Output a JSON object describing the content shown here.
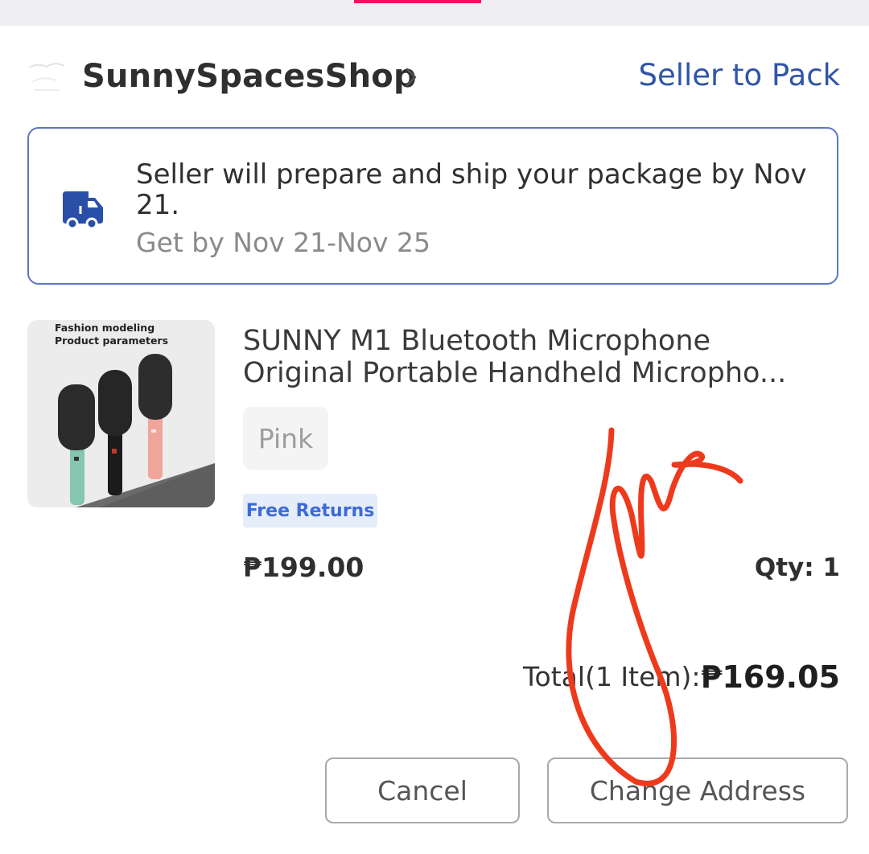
{
  "order": {
    "shop_name": "SunnySpacesShop",
    "status": "Seller to Pack",
    "shipping": {
      "message": "Seller will prepare and ship your package by Nov 21.",
      "estimate": "Get by Nov 21-Nov 25"
    },
    "item": {
      "thumbnail_text": {
        "line1": "Fashion modeling",
        "line2": "Product parameters"
      },
      "title_line1": "SUNNY M1 Bluetooth Microphone",
      "title_line2": "Original Portable Handheld Micropho...",
      "variant": "Pink",
      "badge": "Free Returns",
      "price": "₱199.00",
      "qty": "Qty: 1"
    },
    "total_label": "Total(1 Item):",
    "total_value": "₱169.05",
    "buttons": {
      "cancel": "Cancel",
      "change_address": "Change Address"
    }
  },
  "colors": {
    "accent_pink": "#f0135f",
    "status_blue": "#2f55a8",
    "badge_blue": "#3d6ad6",
    "scribble_red": "#ee3a1c"
  },
  "icons": [
    "shop-logo-icon",
    "chevron-right-icon",
    "truck-icon"
  ]
}
